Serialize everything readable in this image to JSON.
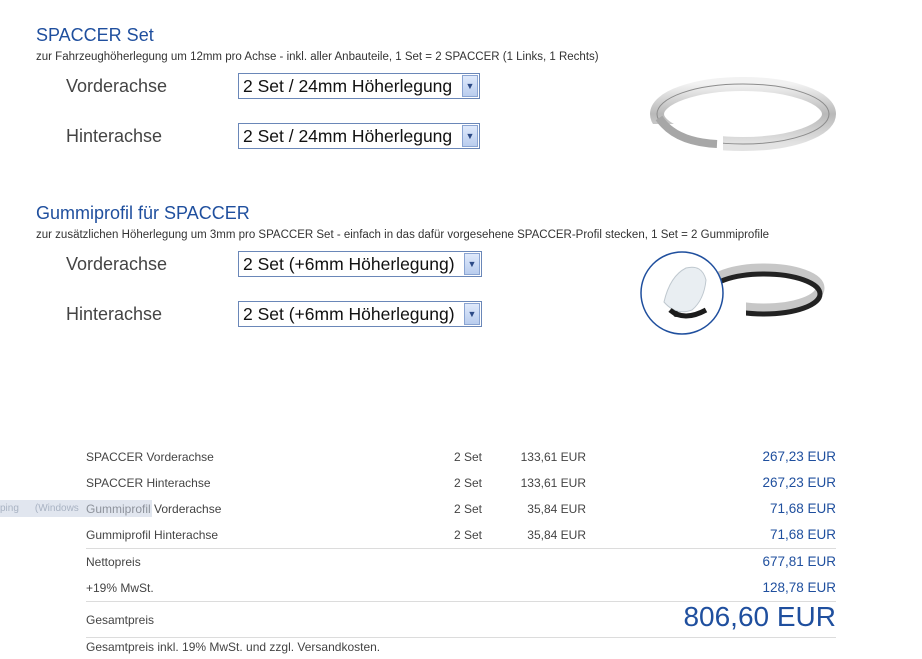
{
  "spaccer": {
    "title": "SPACCER Set",
    "subtitle": "zur Fahrzeughöherlegung um 12mm pro Achse - inkl. aller Anbauteile, 1 Set = 2 SPACCER (1 Links, 1 Rechts)",
    "front_label": "Vorderachse",
    "front_value": "2 Set / 24mm Höherlegung",
    "rear_label": "Hinterachse",
    "rear_value": "2 Set / 24mm Höherlegung"
  },
  "gummi": {
    "title": "Gummiprofil für SPACCER",
    "subtitle": "zur zusätzlichen Höherlegung um 3mm pro SPACCER Set - einfach in das dafür vorgesehene SPACCER-Profil stecken, 1 Set = 2 Gummiprofile",
    "front_label": "Vorderachse",
    "front_value": "2 Set (+6mm Höherlegung)",
    "rear_label": "Hinterachse",
    "rear_value": "2 Set (+6mm Höherlegung)"
  },
  "summary": {
    "items": [
      {
        "label": "SPACCER Vorderachse",
        "qty": "2 Set",
        "unit": "133,61 EUR",
        "total": "267,23 EUR"
      },
      {
        "label": "SPACCER Hinterachse",
        "qty": "2 Set",
        "unit": "133,61 EUR",
        "total": "267,23 EUR"
      },
      {
        "label": "Gummiprofil Vorderachse",
        "qty": "2 Set",
        "unit": "35,84 EUR",
        "total": "71,68 EUR"
      },
      {
        "label": "Gummiprofil Hinterachse",
        "qty": "2 Set",
        "unit": "35,84 EUR",
        "total": "71,68 EUR"
      }
    ],
    "net_label": "Nettopreis",
    "net_value": "677,81 EUR",
    "vat_label": "+19% MwSt.",
    "vat_value": "128,78 EUR",
    "gross_label": "Gesamtpreis",
    "gross_value": "806,60 EUR",
    "footnote": "Gesamtpreis inkl. 19% MwSt. und zzgl. Versandkosten."
  },
  "overlay": {
    "left_text": "ping",
    "right_text": "(Windows"
  },
  "colors": {
    "accent": "#1f4f9e",
    "text": "#333333"
  }
}
